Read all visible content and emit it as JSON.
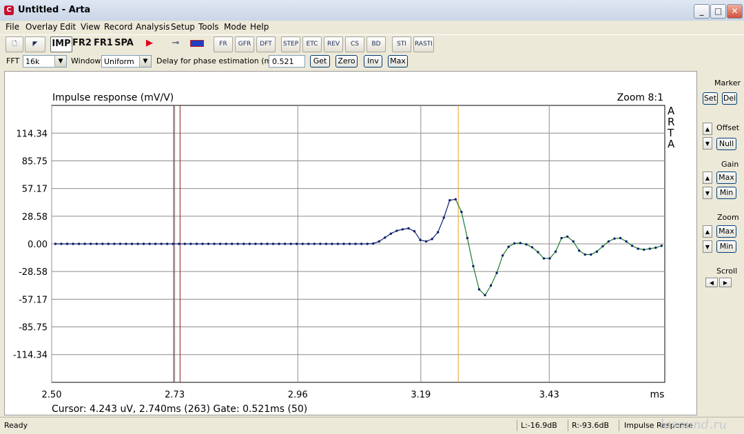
{
  "window": {
    "title": "Untitled - Arta",
    "icon": "arta-app-icon",
    "controls": [
      "minimize",
      "maximize",
      "close"
    ]
  },
  "menu": [
    "File",
    "Overlay",
    "Edit",
    "View",
    "Record",
    "Analysis",
    "Setup",
    "Tools",
    "Mode",
    "Help"
  ],
  "toolbar": {
    "mode_buttons": [
      "IMP",
      "FR2",
      "FR1",
      "SPA"
    ],
    "tool_labels": [
      "FR",
      "GFR",
      "DFT",
      "STEP",
      "ETC",
      "REV",
      "CS",
      "BD",
      "STI",
      "RASTI"
    ]
  },
  "controls": {
    "fft_label": "FFT",
    "fft_value": "16k",
    "window_label": "Window",
    "window_value": "Uniform",
    "delay_label": "Delay for phase estimation (ms)",
    "delay_value": "0.521",
    "buttons": [
      "Get",
      "Zero",
      "Inv",
      "Max"
    ]
  },
  "chart_data": {
    "type": "line",
    "title": "Impulse response (mV/V)",
    "zoom_text": "Zoom 8:1",
    "brand_text": [
      "A",
      "R",
      "T",
      "A"
    ],
    "xlabel": "ms",
    "ylabel": "",
    "x_ticks": [
      "2.50",
      "2.73",
      "2.96",
      "3.19",
      "3.43"
    ],
    "y_ticks": [
      "114.34",
      "85.75",
      "57.17",
      "28.58",
      "0.00",
      "-28.58",
      "-57.17",
      "-85.75",
      "-114.34"
    ],
    "xlim": [
      2.5,
      3.646
    ],
    "ylim": [
      -143,
      143
    ],
    "grid": true,
    "cursor_ms": 2.74,
    "gate_marker_ms": 2.728,
    "phase_marker_ms": 3.26,
    "series": [
      {
        "color": "#0a1f6e",
        "x": [
          2.507,
          2.518,
          2.529,
          2.54,
          2.551,
          2.562,
          2.573,
          2.584,
          2.595,
          2.606,
          2.617,
          2.628,
          2.639,
          2.65,
          2.661,
          2.672,
          2.683,
          2.694,
          2.705,
          2.716,
          2.727,
          2.738,
          2.749,
          2.76,
          2.771,
          2.782,
          2.793,
          2.804,
          2.815,
          2.826,
          2.837,
          2.848,
          2.859,
          2.87,
          2.881,
          2.892,
          2.903,
          2.914,
          2.925,
          2.936,
          2.947,
          2.958,
          2.969,
          2.98,
          2.991,
          3.002,
          3.013,
          3.024,
          3.035,
          3.046,
          3.057,
          3.068,
          3.079,
          3.09,
          3.101,
          3.112,
          3.123,
          3.134,
          3.145,
          3.156,
          3.167,
          3.178,
          3.189,
          3.2,
          3.211,
          3.222,
          3.233,
          3.244,
          3.255
        ],
        "y": [
          0,
          0,
          0,
          0,
          0,
          0,
          0,
          0,
          0,
          0,
          0,
          0,
          0,
          0,
          0,
          0,
          0,
          0,
          0,
          0,
          0,
          0,
          0,
          0,
          0,
          0,
          0,
          0,
          0,
          0,
          0,
          0,
          0,
          0,
          0,
          0,
          0,
          0,
          0,
          0,
          0,
          0,
          0,
          0,
          0,
          0,
          0,
          0,
          0,
          0,
          0,
          0,
          0,
          0,
          0.3,
          2.5,
          6.5,
          10.5,
          13.5,
          15.0,
          16.0,
          13.0,
          4.0,
          2.5,
          5.0,
          12.0,
          27.0,
          45.0,
          46.0
        ]
      },
      {
        "color": "#1a7a2a",
        "x": [
          3.266,
          3.277,
          3.288,
          3.299,
          3.31,
          3.321,
          3.332,
          3.343,
          3.354,
          3.365,
          3.376,
          3.387,
          3.398,
          3.409,
          3.42,
          3.431,
          3.442,
          3.453,
          3.464,
          3.475,
          3.486,
          3.497,
          3.508,
          3.519,
          3.53,
          3.541,
          3.552,
          3.563,
          3.574,
          3.585,
          3.596,
          3.607,
          3.618,
          3.629,
          3.64
        ],
        "y": [
          33.0,
          6.0,
          -23.0,
          -47.0,
          -53.0,
          -43.0,
          -30.0,
          -12.0,
          -3.0,
          0.5,
          0.8,
          -0.5,
          -3.5,
          -8.5,
          -15.0,
          -15.0,
          -8.0,
          6.0,
          7.5,
          2.5,
          -7.0,
          -11.0,
          -11.0,
          -8.0,
          -2.5,
          2.5,
          5.5,
          6.0,
          2.5,
          -2.0,
          -5.0,
          -6.0,
          -5.0,
          -4.0,
          -2.0
        ]
      }
    ],
    "cursor_text": "Cursor: 4.243 uV, 2.740ms (263)  Gate: 0.521ms (50)"
  },
  "right_panel": {
    "marker_label": "Marker",
    "set_label": "Set",
    "del_label": "Del",
    "offset_label": "Offset",
    "null_label": "Null",
    "gain_label": "Gain",
    "gain_max": "Max",
    "gain_min": "Min",
    "zoom_label": "Zoom",
    "zoom_max": "Max",
    "zoom_min": "Min",
    "scroll_label": "Scroll"
  },
  "status": {
    "ready": "Ready",
    "left": "L:-16.9dB",
    "right": "R:-93.6dB",
    "mode": "Impulse Response",
    "watermark": "lasound.ru"
  },
  "colors": {
    "gate_line": "#8b1a1a",
    "phase_line": "#e8a030",
    "trace_pre": "#0a1f6e",
    "trace_post": "#1a7a2a"
  }
}
